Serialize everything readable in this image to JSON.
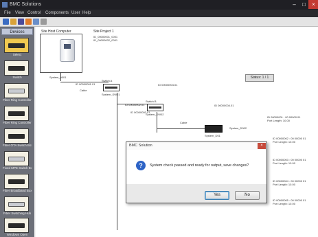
{
  "window": {
    "title": "BMC Solutions"
  },
  "menu": [
    "File",
    "View",
    "Control",
    "Components",
    "User",
    "Help"
  ],
  "palette": {
    "header": "Devices",
    "items": [
      {
        "label": "Select",
        "selected": true
      },
      {
        "label": "Switch"
      },
      {
        "label": "Fiber Ring Controller"
      },
      {
        "label": "Fiber Ring Controller"
      },
      {
        "label": "Fiber OTA Switch Box"
      },
      {
        "label": "Fixed MPE Switch Box"
      },
      {
        "label": "Fiber Broadband Box"
      },
      {
        "label": "Fiber Switching Hub"
      },
      {
        "label": "Windows Open"
      }
    ]
  },
  "canvas": {
    "device_box_label": "Site Host Computer",
    "site_label": "Site Project 1",
    "site_sub1": "ID_00000001_0001",
    "site_sub2": "ID_00000002_0001",
    "status_box": "Status: 1 / 1",
    "labels": {
      "n1": "System_0001",
      "n1b": "Cable",
      "n2": "System_SW01",
      "n2b": "Switch A",
      "n3": "System_SW02",
      "n3b": "Switch B",
      "n4": "System_D01",
      "n4b": "Cable",
      "l1": "ID 00000001.01",
      "l2": "ID 00000002.01",
      "l3": "ID 00000003.01",
      "l4": "ID 00000004.01",
      "l5": "System_D002",
      "r1": "ID 00000001 : 00 00000 01",
      "r1b": "Port Length: 10.00",
      "r2": "ID 00000002 : 00 00000 01",
      "r2b": "Port Length: 10.00",
      "r3": "ID 00000003 : 00 00000 01",
      "r3b": "Port Length: 10.00",
      "r4": "ID 00000004 : 00 00000 01",
      "r4b": "Port Length: 10.00",
      "r5": "ID 00000005 : 00 00000 01",
      "r5b": "Port Length: 10.00"
    }
  },
  "dialog": {
    "title": "BMC Solution",
    "close": "×",
    "icon": "?",
    "message": "System check passed and ready for output, save changes?",
    "yes": "Yes",
    "no": "No"
  },
  "colors": {
    "titlebar": "#1f1f24",
    "palette": "#6c6f78",
    "selection": "#f0c850",
    "dialog_accent": "#2d63c6"
  }
}
